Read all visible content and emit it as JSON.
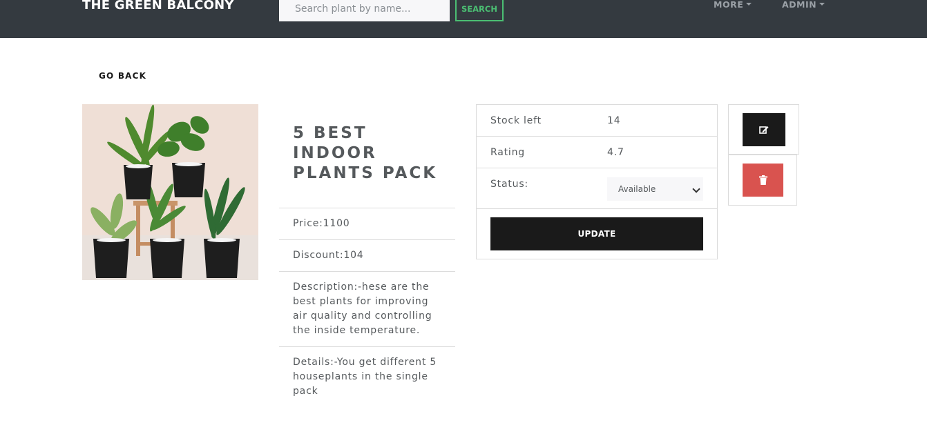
{
  "nav": {
    "brand": "THE GREEN BALCONY",
    "search_placeholder": "Search plant by name...",
    "search_label": "SEARCH",
    "more_label": "MORE",
    "admin_label": "ADMIN"
  },
  "page": {
    "go_back_label": "GO BACK"
  },
  "product": {
    "title": "5 BEST INDOOR PLANTS PACK",
    "price": "Price:1100",
    "discount": "Discount:104",
    "description": "Description:-hese are the best plants for improving air quality and controlling the inside temperature.",
    "details": "Details:-You get different 5 houseplants in the single pack"
  },
  "stock": {
    "stock_label": "Stock left",
    "stock_value": "14",
    "rating_label": "Rating",
    "rating_value": "4.7",
    "status_label": "Status:",
    "status_selected": "Available",
    "update_label": "UPDATE"
  },
  "actions": {
    "edit_icon": "edit-icon",
    "delete_icon": "trash-icon",
    "delete_color": "#d9534f"
  },
  "colors": {
    "navbar": "#343a40",
    "accent_green": "#4bbf73",
    "dark_button": "#1a1a1a"
  }
}
